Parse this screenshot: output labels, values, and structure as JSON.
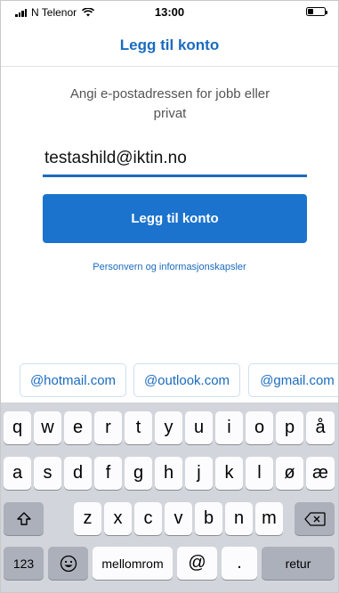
{
  "status_bar": {
    "carrier": "N Telenor",
    "time": "13:00"
  },
  "header": {
    "title": "Legg til konto"
  },
  "prompt": "Angi e-postadressen for jobb eller privat",
  "email_input": {
    "value": "testashild@iktin.no"
  },
  "primary_button": "Legg til konto",
  "privacy_link": "Personvern og informasjonskapsler",
  "suggestions": [
    "@hotmail.com",
    "@outlook.com",
    "@gmail.com"
  ],
  "keyboard": {
    "row1": [
      "q",
      "w",
      "e",
      "r",
      "t",
      "y",
      "u",
      "i",
      "o",
      "p",
      "å"
    ],
    "row2": [
      "a",
      "s",
      "d",
      "f",
      "g",
      "h",
      "j",
      "k",
      "l",
      "ø",
      "æ"
    ],
    "row3": [
      "z",
      "x",
      "c",
      "v",
      "b",
      "n",
      "m"
    ],
    "numbers_key": "123",
    "space_key": "mellomrom",
    "at_key": "@",
    "dot_key": ".",
    "return_key": "retur",
    "shift_icon": "shift-icon",
    "backspace_icon": "backspace-icon",
    "emoji_icon": "emoji-icon"
  },
  "colors": {
    "accent": "#1b73cd",
    "keyboard_bg": "#d2d5db",
    "key_bg": "#fcfcfe",
    "dark_key_bg": "#abb0ba"
  }
}
